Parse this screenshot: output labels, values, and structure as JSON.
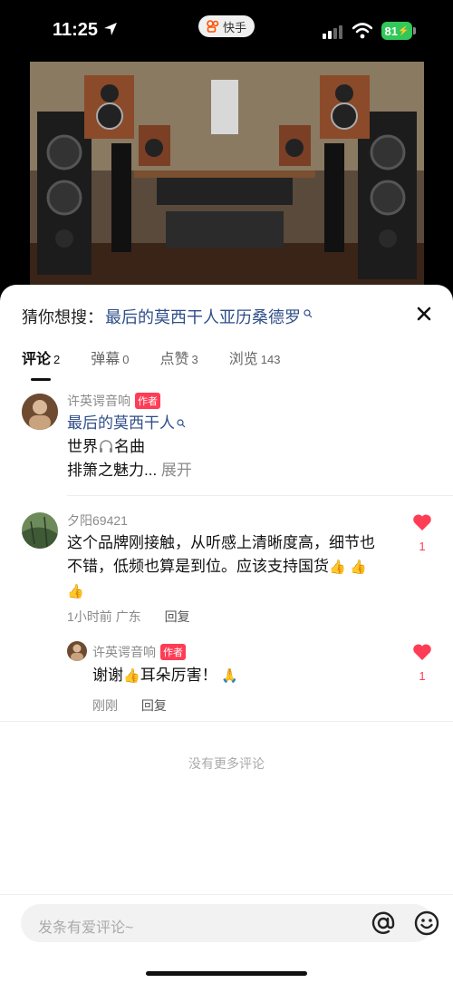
{
  "status_bar": {
    "time": "11:25",
    "app_name": "快手",
    "battery": "81"
  },
  "suggestion": {
    "prefix": "猜你想搜：",
    "keyword": "最后的莫西干人亚历桑德罗"
  },
  "tabs": [
    {
      "label": "评论",
      "count": "2"
    },
    {
      "label": "弹幕",
      "count": "0"
    },
    {
      "label": "点赞",
      "count": "3"
    },
    {
      "label": "浏览",
      "count": "143"
    }
  ],
  "post": {
    "author": "许英谔音响",
    "badge": "作者",
    "keyword": "最后的莫西干人",
    "line1_a": "世界",
    "line1_b": "名曲",
    "line2": "排箫之魅力...",
    "expand": "展开"
  },
  "comments": [
    {
      "user": "夕阳69421",
      "line1": "这个品牌刚接触，从听感上清晰度高，细节也",
      "line2": "不错，低频也算是到位。应该支持国货",
      "emoji": "👍",
      "time": "1小时前",
      "region": "广东",
      "reply_label": "回复",
      "likes": "1"
    }
  ],
  "reply": {
    "user": "许英谔音响",
    "badge": "作者",
    "text_a": "谢谢",
    "text_b": "耳朵厉害！",
    "thumb": "👍",
    "pray": "🙏",
    "time": "刚刚",
    "reply_label": "回复",
    "likes": "1"
  },
  "no_more": "没有更多评论",
  "input": {
    "placeholder": "发条有爱评论~"
  },
  "colors": {
    "accent_red": "#fe3c55",
    "link_blue": "#2f4e8a",
    "battery_green": "#32c759"
  }
}
